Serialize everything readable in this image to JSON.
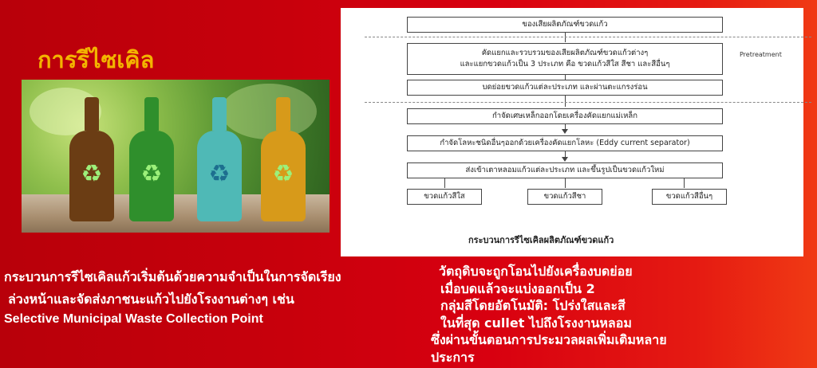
{
  "title": "การรีไซเคิล",
  "photo": {
    "icons": [
      "recycle-icon",
      "recycle-icon",
      "recycle-icon",
      "recycle-icon"
    ]
  },
  "diagram": {
    "pretreatment_label": "Pretreatment",
    "steps": [
      "ของเสียผลิตภัณฑ์ขวดแก้ว",
      "คัดแยกและรวบรวมของเสียผลิตภัณฑ์ขวดแก้วต่างๆ",
      "และแยกขวดแก้วเป็น 3 ประเภท คือ ขวดแก้วสีใส สีชา และสีอื่นๆ",
      "บดย่อยขวดแก้วแต่ละประเภท และผ่านตะแกรงร่อน",
      "กำจัดเศษเหล็กออกโดยเครื่องคัดแยกแม่เหล็ก",
      "กำจัดโลหะชนิดอื่นๆออกด้วยเครื่องคัดแยกโลหะ (Eddy current separator)",
      "ส่งเข้าเตาหลอมแก้วแต่ละประเภท และขึ้นรูปเป็นขวดแก้วใหม่"
    ],
    "outputs": [
      "ขวดแก้วสีใส",
      "ขวดแก้วสีชา",
      "ขวดแก้วสีอื่นๆ"
    ],
    "caption": "กระบวนการรีไซเคิลผลิตภัณฑ์ขวดแก้ว"
  },
  "left_text": {
    "line1": "กระบวนการรีไซเคิลแก้วเริ่มต้นด้วยความจำเป็นในการจัดเรียง",
    "line2": "ล่วงหน้าและจัดส่งภาชนะแก้วไปยังโรงงานต่างๆ เช่น",
    "line3": "Selective Municipal Waste Collection Point"
  },
  "right_text": {
    "lines": [
      "วัตถุดิบจะถูกโอนไปยังเครื่องบดย่อย",
      "เมื่อบดแล้วจะแบ่งออกเป็น 2",
      "กลุ่มสีโดยอัตโนมัติ: โปร่งใสและสี",
      "ในที่สุด cullet ไปถึงโรงงานหลอม",
      "ซึ่งผ่านขั้นตอนการประมวลผลเพิ่มเติมหลาย",
      "ประการ"
    ]
  }
}
